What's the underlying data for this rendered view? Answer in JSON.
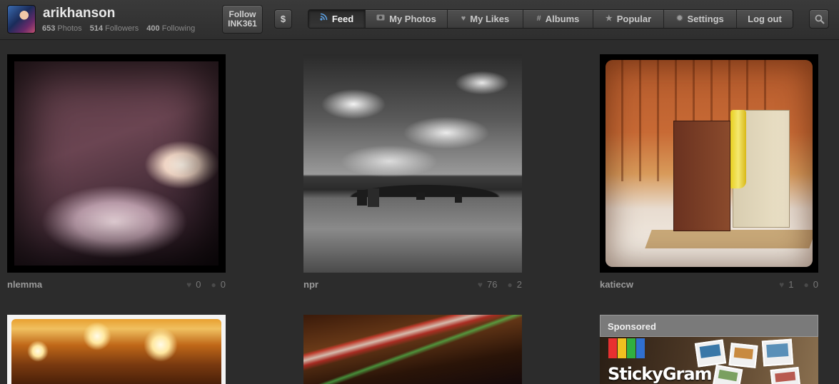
{
  "profile": {
    "username": "arikhanson",
    "photos_count": "653",
    "photos_label": "Photos",
    "followers_count": "514",
    "followers_label": "Followers",
    "following_count": "400",
    "following_label": "Following"
  },
  "actions": {
    "follow_line1": "Follow",
    "follow_line2": "INK361",
    "dollar_label": "$"
  },
  "nav": {
    "feed": "Feed",
    "my_photos": "My Photos",
    "my_likes": "My Likes",
    "albums": "Albums",
    "popular": "Popular",
    "settings": "Settings",
    "logout": "Log out",
    "active": "Feed"
  },
  "feed": [
    {
      "user": "nlemma",
      "likes": "0",
      "comments": "0"
    },
    {
      "user": "npr",
      "likes": "76",
      "comments": "2"
    },
    {
      "user": "katiecw",
      "likes": "1",
      "comments": "0"
    }
  ],
  "sponsored": {
    "heading": "Sponsored",
    "brand": "StickyGram"
  },
  "colors": {
    "background": "#2c2c2c",
    "feed_icon_accent": "#5b9ee0",
    "sponsored_header": "#7a7a7a"
  }
}
